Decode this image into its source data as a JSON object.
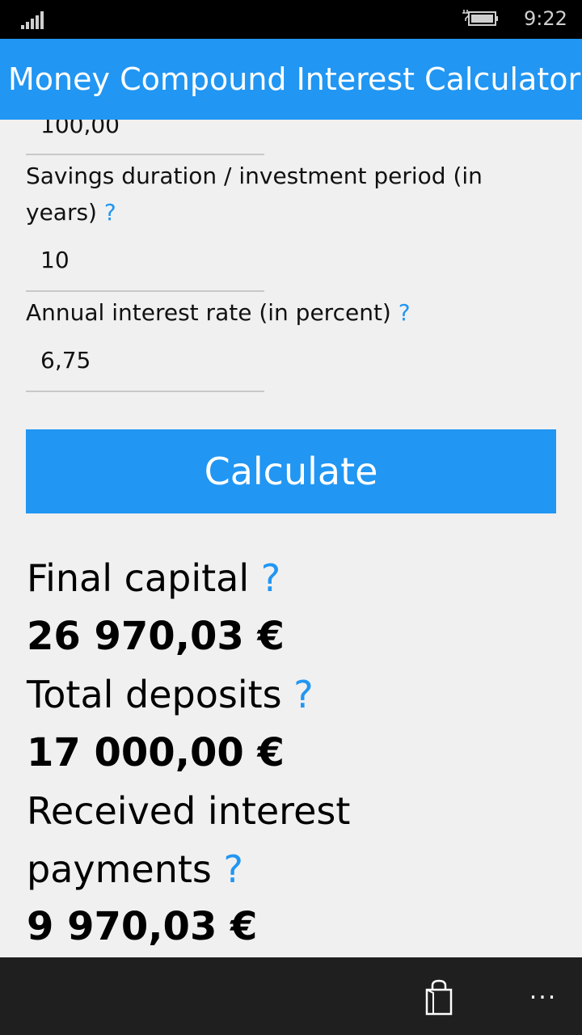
{
  "status_bar": {
    "time": "9:22",
    "icons": [
      "signal-strength-icon",
      "battery-charging-icon"
    ]
  },
  "header": {
    "title": "Money Compound Interest Calculator"
  },
  "form": {
    "partial_field": {
      "value": "100,00"
    },
    "duration": {
      "label": "Savings duration / investment period (in years)",
      "help": "?",
      "value": "10"
    },
    "rate": {
      "label": "Annual interest rate (in percent)",
      "help": "?",
      "value": "6,75"
    },
    "calculate_label": "Calculate"
  },
  "results": {
    "final_capital": {
      "label": "Final capital",
      "help": "?",
      "value": "26 970,03 €"
    },
    "total_deposits": {
      "label": "Total deposits",
      "help": "?",
      "value": "17 000,00 €"
    },
    "received_interest": {
      "label_line1": "Received interest",
      "label_line2": "payments",
      "help": "?",
      "value": "9 970,03 €"
    }
  },
  "app_bar": {
    "icons": [
      "store-icon"
    ],
    "more_label": "..."
  },
  "colors": {
    "accent": "#2196f3",
    "background": "#f0f0f0",
    "status_bar": "#000000",
    "app_bar": "#1f1f1f"
  }
}
